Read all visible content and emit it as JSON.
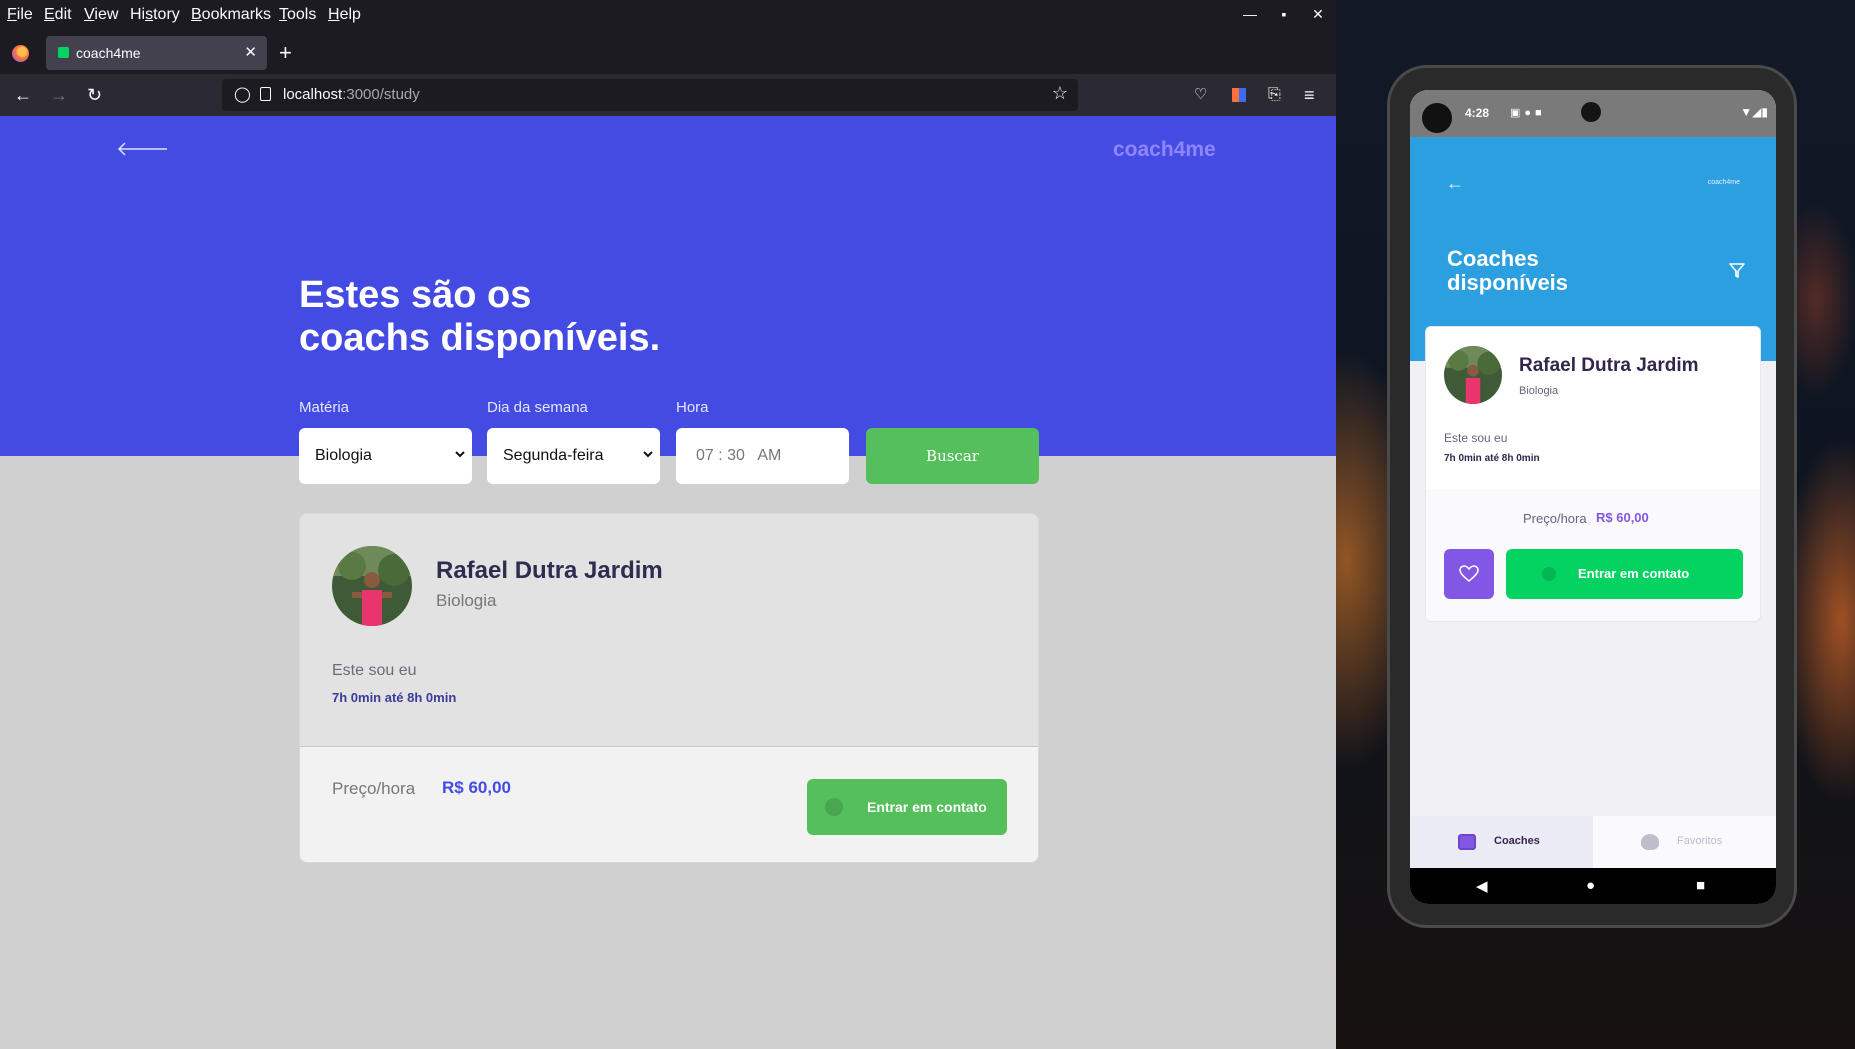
{
  "browser": {
    "menu": [
      "File",
      "Edit",
      "View",
      "History",
      "Bookmarks",
      "Tools",
      "Help"
    ],
    "menu_access_keys": [
      "F",
      "E",
      "V",
      "s",
      "B",
      "T",
      "H"
    ],
    "tab_title": "coach4me",
    "url_host": "localhost",
    "url_path": ":3000/study"
  },
  "page": {
    "brand": "coach4me",
    "title_line1": "Estes são os",
    "title_line2": "coachs disponíveis.",
    "filters": {
      "subject_label": "Matéria",
      "subject_value": "Biologia",
      "weekday_label": "Dia da semana",
      "weekday_value": "Segunda-feira",
      "time_label": "Hora",
      "time_value": "07 : 30   AM",
      "search_button": "Buscar"
    },
    "coach": {
      "name": "Rafael Dutra Jardim",
      "subject": "Biologia",
      "bio": "Este sou eu",
      "schedule": "7h 0min até 8h 0min",
      "price_label": "Preço/hora",
      "price_value": "R$ 60,00",
      "contact_button": "Entrar em contato"
    }
  },
  "phone": {
    "status_time": "4:28",
    "brand": "coach4me",
    "title_line1": "Coaches",
    "title_line2": "disponíveis",
    "coach": {
      "name": "Rafael Dutra Jardim",
      "subject": "Biologia",
      "bio": "Este sou eu",
      "schedule": "7h 0min até 8h 0min",
      "price_label": "Preço/hora",
      "price_value": "R$ 60,00",
      "contact_button": "Entrar em contato"
    },
    "tabs": {
      "coaches": "Coaches",
      "favorites": "Favoritos"
    }
  },
  "colors": {
    "hero": "#444be3",
    "green": "#55bf5b",
    "mobile_header": "#2b9fe0",
    "mobile_purple": "#8257e5",
    "mobile_green": "#04d361"
  }
}
